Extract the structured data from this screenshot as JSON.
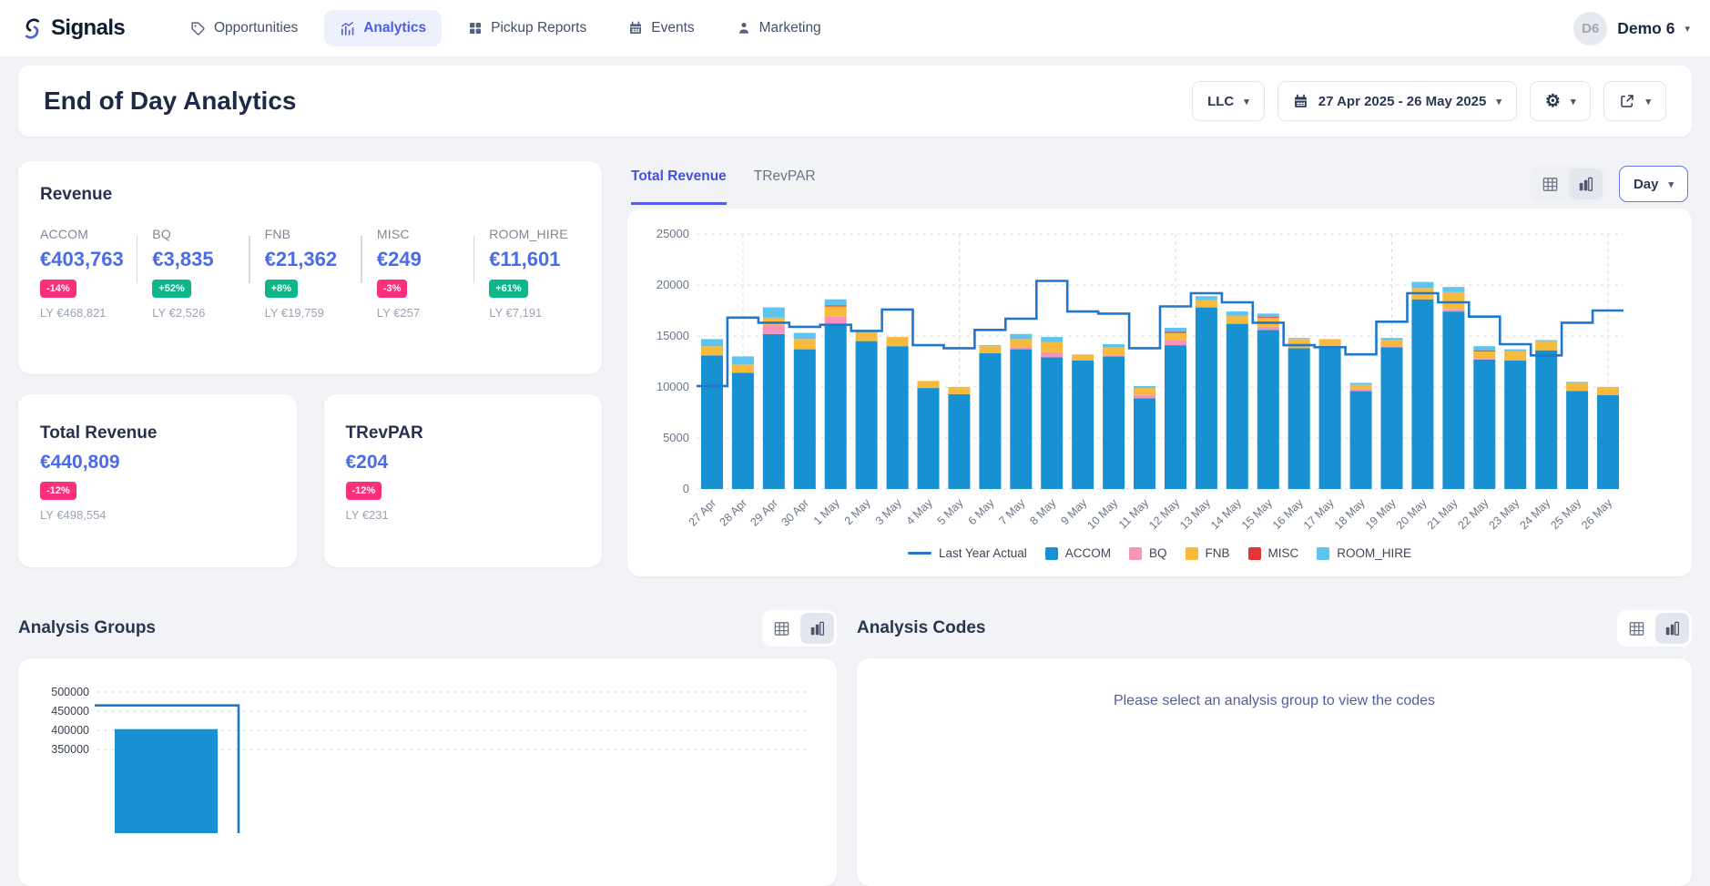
{
  "nav": {
    "brand": "Signals",
    "items": [
      {
        "label": "Opportunities",
        "icon": "tag-icon",
        "active": false
      },
      {
        "label": "Analytics",
        "icon": "analytics-icon",
        "active": true
      },
      {
        "label": "Pickup Reports",
        "icon": "grid-icon",
        "active": false
      },
      {
        "label": "Events",
        "icon": "calendar-icon",
        "active": false
      },
      {
        "label": "Marketing",
        "icon": "person-icon",
        "active": false
      }
    ],
    "user": {
      "initials": "D6",
      "name": "Demo 6"
    }
  },
  "header": {
    "title": "End of Day Analytics",
    "llc_label": "LLC",
    "date_range": "27 Apr 2025 - 26 May 2025"
  },
  "revenue_card": {
    "title": "Revenue",
    "metrics": [
      {
        "label": "ACCOM",
        "value": "€403,763",
        "change": "-14%",
        "direction": "down",
        "ly": "LY €468,821"
      },
      {
        "label": "BQ",
        "value": "€3,835",
        "change": "+52%",
        "direction": "up",
        "ly": "LY €2,526"
      },
      {
        "label": "FNB",
        "value": "€21,362",
        "change": "+8%",
        "direction": "up",
        "ly": "LY €19,759"
      },
      {
        "label": "MISC",
        "value": "€249",
        "change": "-3%",
        "direction": "down",
        "ly": "LY €257"
      },
      {
        "label": "ROOM_HIRE",
        "value": "€11,601",
        "change": "+61%",
        "direction": "up",
        "ly": "LY €7,191"
      }
    ]
  },
  "summary_cards": [
    {
      "title": "Total Revenue",
      "value": "€440,809",
      "change": "-12%",
      "direction": "down",
      "ly": "LY €498,554"
    },
    {
      "title": "TRevPAR",
      "value": "€204",
      "change": "-12%",
      "direction": "down",
      "ly": "LY €231"
    }
  ],
  "chart_panel": {
    "tabs": [
      {
        "label": "Total Revenue",
        "active": true
      },
      {
        "label": "TRevPAR",
        "active": false
      }
    ],
    "granularity": "Day"
  },
  "chart_data": [
    {
      "name": "total-revenue-by-day",
      "type": "bar",
      "stacked": true,
      "categories": [
        "27 Apr",
        "28 Apr",
        "29 Apr",
        "30 Apr",
        "1 May",
        "2 May",
        "3 May",
        "4 May",
        "5 May",
        "6 May",
        "7 May",
        "8 May",
        "9 May",
        "10 May",
        "11 May",
        "12 May",
        "13 May",
        "14 May",
        "15 May",
        "16 May",
        "17 May",
        "18 May",
        "19 May",
        "20 May",
        "21 May",
        "22 May",
        "23 May",
        "24 May",
        "25 May",
        "26 May"
      ],
      "series": [
        {
          "name": "ACCOM",
          "color": "#1791d1",
          "values": [
            13100,
            11400,
            15200,
            13700,
            16100,
            14500,
            14000,
            9900,
            9300,
            13300,
            13700,
            12900,
            12600,
            13000,
            8900,
            14100,
            17800,
            16200,
            15600,
            13800,
            14000,
            9600,
            13900,
            18600,
            17400,
            12700,
            12600,
            13600,
            9600,
            9200
          ]
        },
        {
          "name": "BQ",
          "color": "#f794bd",
          "values": [
            0,
            0,
            900,
            0,
            800,
            0,
            0,
            0,
            0,
            0,
            200,
            500,
            0,
            100,
            300,
            500,
            0,
            0,
            300,
            0,
            0,
            200,
            100,
            0,
            200,
            100,
            0,
            0,
            0,
            0
          ]
        },
        {
          "name": "FNB",
          "color": "#f8ba3d",
          "values": [
            900,
            800,
            700,
            1000,
            1000,
            1000,
            900,
            700,
            700,
            700,
            800,
            1000,
            600,
            800,
            700,
            700,
            700,
            800,
            900,
            900,
            700,
            400,
            600,
            1100,
            1700,
            700,
            900,
            900,
            800,
            800
          ]
        },
        {
          "name": "MISC",
          "color": "#e23636",
          "values": [
            0,
            0,
            0,
            0,
            100,
            0,
            0,
            0,
            0,
            0,
            0,
            0,
            0,
            0,
            0,
            100,
            0,
            0,
            100,
            0,
            0,
            0,
            0,
            0,
            0,
            100,
            0,
            0,
            0,
            0
          ]
        },
        {
          "name": "ROOM_HIRE",
          "color": "#5ec3ee",
          "values": [
            700,
            800,
            1000,
            600,
            600,
            100,
            0,
            0,
            0,
            100,
            500,
            500,
            0,
            300,
            200,
            400,
            400,
            400,
            300,
            100,
            0,
            200,
            200,
            600,
            500,
            400,
            200,
            100,
            100,
            0
          ]
        }
      ],
      "line_series": {
        "name": "Last Year Actual",
        "color": "#2077cb",
        "style": "step",
        "values": [
          10100,
          16800,
          16300,
          15900,
          16100,
          15500,
          17600,
          14100,
          13800,
          15600,
          16700,
          20400,
          17400,
          17200,
          13800,
          17900,
          19200,
          18300,
          16300,
          14100,
          13900,
          13200,
          16400,
          19200,
          18300,
          16900,
          14200,
          13100,
          16300,
          17500
        ]
      },
      "ylim": [
        0,
        25000
      ],
      "yticks": [
        0,
        5000,
        10000,
        15000,
        20000,
        25000
      ],
      "grid": true,
      "vertical_gridline_indices": [
        1,
        8,
        15,
        22,
        29
      ],
      "legend_position": "bottom"
    },
    {
      "name": "analysis-groups-chart",
      "type": "bar",
      "categories": [
        ""
      ],
      "series": [
        {
          "name": "Actual",
          "color": "#1791d1",
          "values": [
            403000
          ]
        }
      ],
      "line_series": {
        "name": "Last Year Actual",
        "color": "#2077cb",
        "style": "step",
        "values": [
          465000
        ]
      },
      "yticks": [
        350000,
        400000,
        450000,
        500000
      ],
      "note": "partially visible, clipped by viewport bottom"
    }
  ],
  "analysis_groups": {
    "title": "Analysis Groups"
  },
  "analysis_codes": {
    "title": "Analysis Codes",
    "empty_message": "Please select an analysis group to view the codes"
  },
  "colors": {
    "accent_blue": "#4a6ce9",
    "active_nav": "#4c5ee4",
    "badge_negative": "#f9307c",
    "badge_positive": "#0db78a",
    "bar_accom": "#1791d1",
    "bar_bq": "#f794bd",
    "bar_fnb": "#f8ba3d",
    "bar_misc": "#e23636",
    "bar_room_hire": "#5ec3ee",
    "line_last_year": "#2077cb",
    "tab_underline": "#5a5be6",
    "page_background": "#f2f3f6"
  }
}
